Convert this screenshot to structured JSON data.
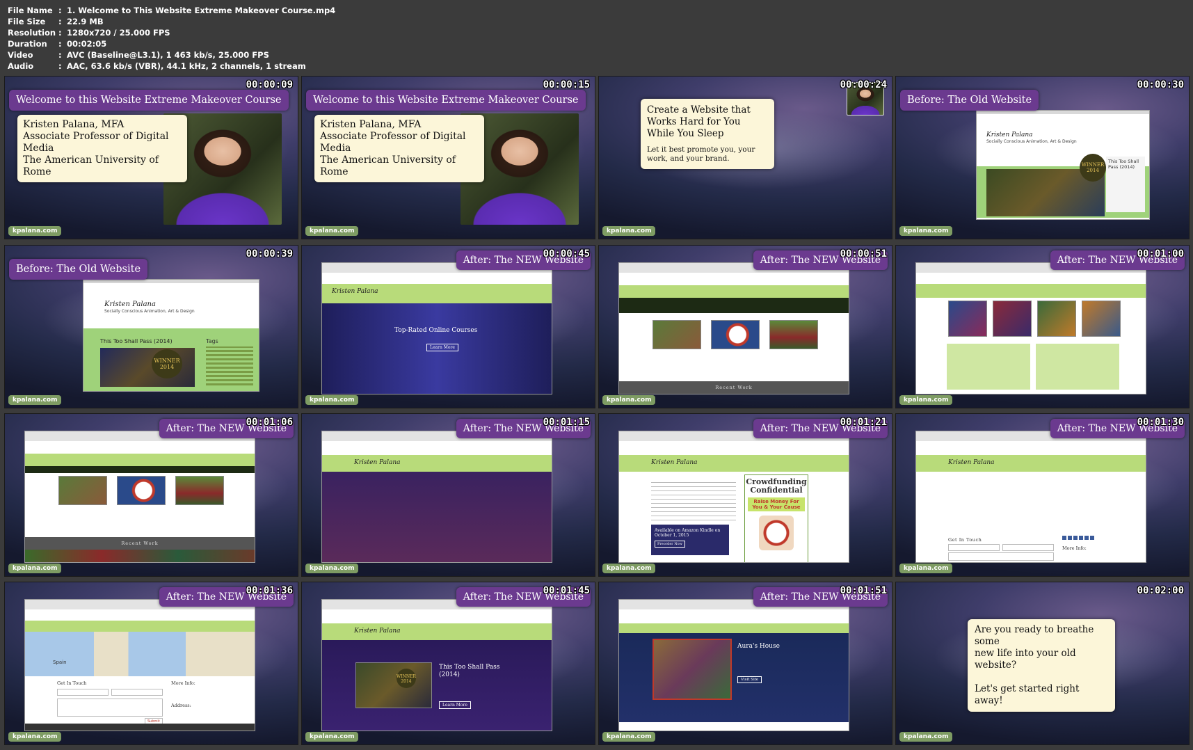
{
  "info": [
    {
      "key": "File Name",
      "value": "1. Welcome to This Website Extreme Makeover Course.mp4"
    },
    {
      "key": "File Size",
      "value": "22.9 MB"
    },
    {
      "key": "Resolution",
      "value": "1280x720 / 25.000 FPS"
    },
    {
      "key": "Duration",
      "value": "00:02:05"
    },
    {
      "key": "Video",
      "value": "AVC (Baseline@L3.1), 1 463 kb/s, 25.000 FPS"
    },
    {
      "key": "Audio",
      "value": "AAC, 63.6 kb/s (VBR), 44.1 kHz, 2 channels, 1 stream"
    }
  ],
  "watermark": "kpalana.com",
  "frames": [
    {
      "time": "00:00:09",
      "banner": "Welcome to this Website Extreme Makeover Course",
      "card": [
        "Kristen Palana, MFA",
        "Associate Professor of Digital Media",
        "The American University of Rome"
      ]
    },
    {
      "time": "00:00:15",
      "banner": "Welcome to this Website Extreme Makeover Course",
      "card": [
        "Kristen Palana, MFA",
        "Associate Professor of Digital Media",
        "The American University of Rome"
      ]
    },
    {
      "time": "00:00:24",
      "card_title": "Create a Website that Works Hard for You While You Sleep",
      "card_body": "Let it best promote you, your work, and your brand."
    },
    {
      "time": "00:00:30",
      "banner": "Before: The Old Website",
      "site_title": "Kristen Palana",
      "site_sub": "Socially Conscious Animation, Art & Design",
      "award": "WINNER",
      "award_year": "2014",
      "side_text": "This Too Shall Pass (2014)"
    },
    {
      "time": "00:00:39",
      "banner": "Before: The Old Website",
      "site_title": "Kristen Palana",
      "site_sub": "Socially Conscious Animation, Art & Design",
      "post_title": "This Too Shall Pass (2014)",
      "award": "WINNER",
      "award_year": "2014",
      "tags_label": "Tags"
    },
    {
      "time": "00:00:45",
      "banner": "After: The NEW Website",
      "site_title": "Kristen Palana",
      "hero_title": "Top-Rated Online Courses",
      "hero_button": "Learn More"
    },
    {
      "time": "00:00:51",
      "banner": "After: The NEW Website",
      "section": "Recent Work"
    },
    {
      "time": "00:01:00",
      "banner": "After: The NEW Website"
    },
    {
      "time": "00:01:06",
      "banner": "After: The NEW Website",
      "section": "Recent Work"
    },
    {
      "time": "00:01:15",
      "banner": "After: The NEW Website",
      "site_title": "Kristen Palana"
    },
    {
      "time": "00:01:21",
      "banner": "After: The NEW Website",
      "site_title": "Kristen Palana",
      "book_title": "Crowdfunding Confidential",
      "book_sub": "Raise Money For You & Your Cause",
      "promo": "Available on Amazon Kindle on October 1, 2015",
      "promo_button": "Preorder Now"
    },
    {
      "time": "00:01:30",
      "banner": "After: The NEW Website",
      "site_title": "Kristen Palana",
      "contact": "Get In Touch",
      "more_info": "More Info:"
    },
    {
      "time": "00:01:36",
      "banner": "After: The NEW Website",
      "map_label": "Spain",
      "contact": "Get In Touch",
      "more_info": "More Info:",
      "address": "Address:",
      "submit": "Submit"
    },
    {
      "time": "00:01:45",
      "banner": "After: The NEW Website",
      "site_title": "Kristen Palana",
      "hero_title": "This Too Shall Pass (2014)",
      "hero_button": "Learn More",
      "award": "WINNER",
      "award_year": "2014"
    },
    {
      "time": "00:01:51",
      "banner": "After: The NEW Website",
      "hero_title": "Aura's House",
      "hero_button": "Visit Site"
    },
    {
      "time": "00:02:00",
      "card_lines": [
        "Are you ready to breathe some",
        "new life into your old website?",
        "",
        "Let's get started right away!"
      ]
    }
  ]
}
